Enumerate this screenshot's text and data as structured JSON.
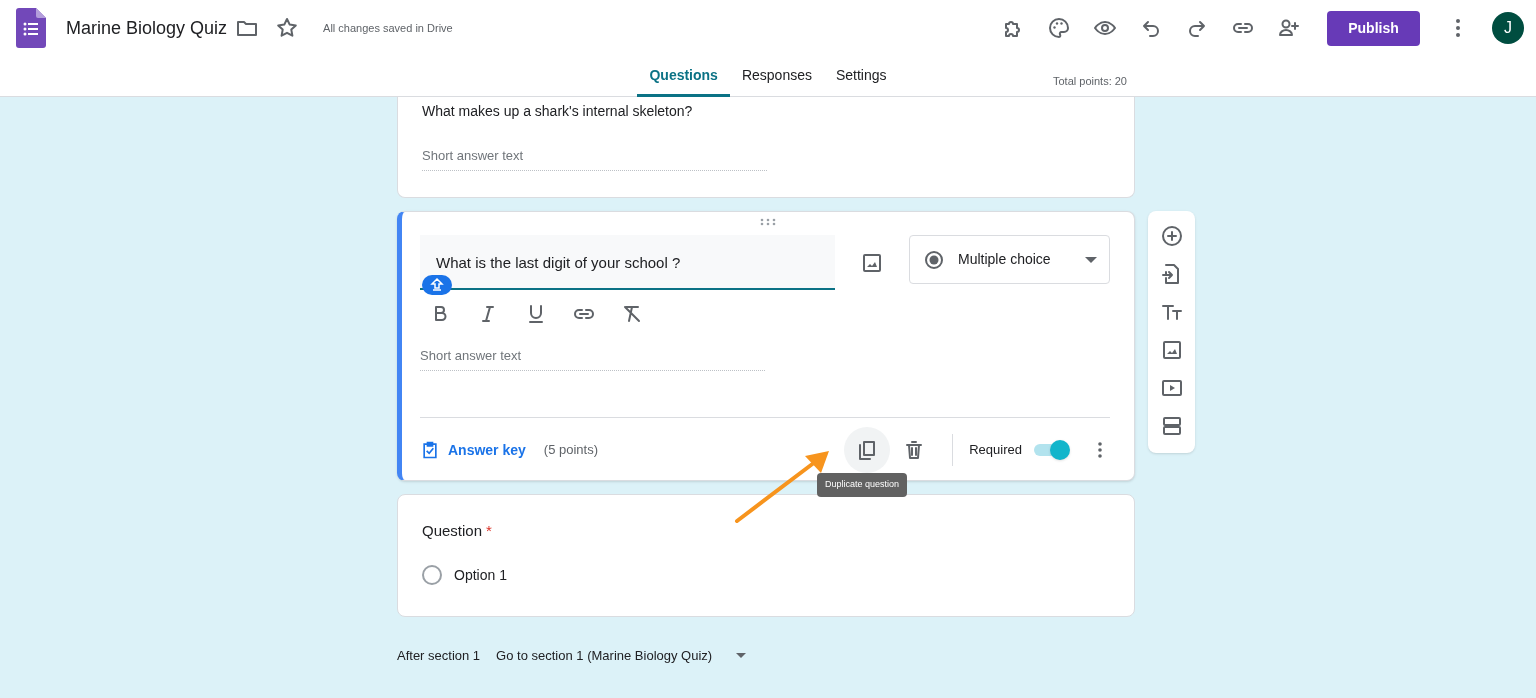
{
  "header": {
    "title": "Marine Biology Quiz",
    "save_status": "All changes saved in Drive",
    "publish": "Publish",
    "avatar": "J"
  },
  "tabs": [
    {
      "label": "Questions",
      "selected": true
    },
    {
      "label": "Responses",
      "selected": false
    },
    {
      "label": "Settings",
      "selected": false
    }
  ],
  "total_points": "Total points: 20",
  "previous_question": {
    "title": "What makes up a shark's internal skeleton?",
    "placeholder": "Short answer text"
  },
  "active_question": {
    "title": "What is the last digit of your school ?",
    "type": "Multiple choice",
    "answer_placeholder": "Short answer text",
    "answer_key": "Answer key",
    "points": "(5 points)",
    "required_label": "Required",
    "required": true,
    "tooltip": "Duplicate question"
  },
  "next_question": {
    "title": "Question",
    "required_mark": "*",
    "options": [
      {
        "label": "Option 1",
        "selected": false
      }
    ]
  },
  "footer": {
    "after": "After section 1",
    "goto": "Go to section 1 (Marine Biology Quiz)"
  }
}
